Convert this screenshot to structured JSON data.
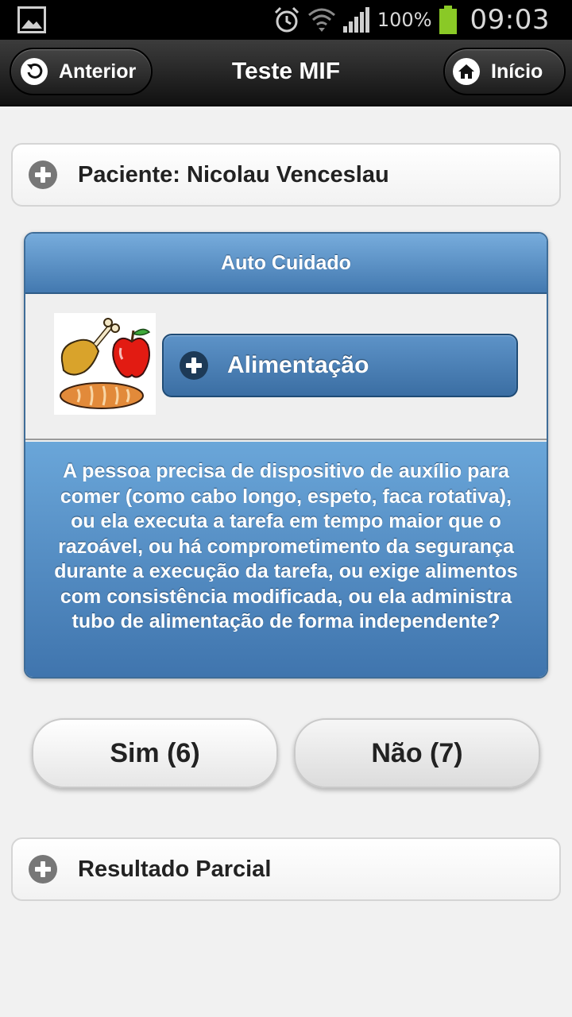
{
  "status_bar": {
    "battery_percent": "100%",
    "time": "09:03",
    "icons": [
      "gallery-icon",
      "alarm-icon",
      "wifi-icon",
      "signal-icon",
      "battery-icon"
    ]
  },
  "header": {
    "title": "Teste MIF",
    "back_label": "Anterior",
    "home_label": "Início"
  },
  "patient": {
    "label": "Paciente: Nicolau Venceslau"
  },
  "card": {
    "section_title": "Auto Cuidado",
    "item_label": "Alimentação",
    "question": "A pessoa precisa de dispositivo de auxílio para comer (como cabo longo, espeto, faca rotativa), ou ela executa a tarefa em tempo maior que o razoável, ou há comprometimento da segurança durante a execução da tarefa, ou exige alimentos com consistência modificada, ou ela administra tubo de alimentação de forma independente?"
  },
  "answers": {
    "yes_label": "Sim (6)",
    "no_label": "Não (7)"
  },
  "partial_result": {
    "label": "Resultado Parcial"
  },
  "colors": {
    "header_bg": "#1c1c1c",
    "card_blue": "#4a7fb5",
    "battery_green": "#8ac926"
  }
}
